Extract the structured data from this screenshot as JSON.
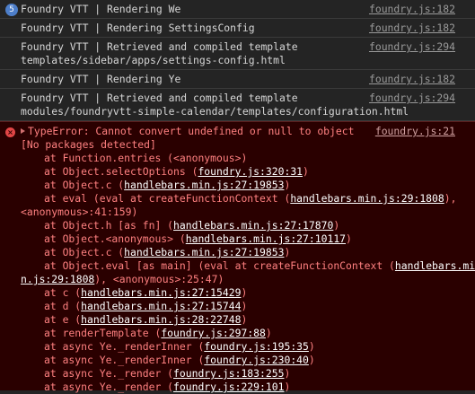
{
  "logs": [
    {
      "count": "5",
      "message": "Foundry VTT | Rendering We",
      "source": "foundry.js:182"
    },
    {
      "message": "Foundry VTT | Rendering SettingsConfig",
      "source": "foundry.js:182"
    },
    {
      "message": "Foundry VTT | Retrieved and compiled template\ntemplates/sidebar/apps/settings-config.html",
      "source": "foundry.js:294"
    },
    {
      "message": "Foundry VTT | Rendering Ye",
      "source": "foundry.js:182"
    },
    {
      "message": "Foundry VTT | Retrieved and compiled template\nmodules/foundryvtt-simple-calendar/templates/configuration.html",
      "source": "foundry.js:294"
    }
  ],
  "error": {
    "title": "TypeError: Cannot convert undefined or null to object",
    "source": "foundry.js:21",
    "detail": "[No packages detected]",
    "stack": [
      {
        "pre": "at Function.entries (<anonymous>)",
        "link": "",
        "post": ""
      },
      {
        "pre": "at Object.selectOptions (",
        "link": "foundry.js:320:31",
        "post": ")"
      },
      {
        "pre": "at Object.c (",
        "link": "handlebars.min.js:27:19853",
        "post": ")"
      },
      {
        "pre": "at eval (eval at createFunctionContext (",
        "link": "handlebars.min.js:29:1808",
        "post": "),"
      },
      {
        "cont": true,
        "pre": "<anonymous>:41:159)",
        "link": "",
        "post": ""
      },
      {
        "pre": "at Object.h [as fn] (",
        "link": "handlebars.min.js:27:17870",
        "post": ")"
      },
      {
        "pre": "at Object.<anonymous> (",
        "link": "handlebars.min.js:27:10117",
        "post": ")"
      },
      {
        "pre": "at Object.c (",
        "link": "handlebars.min.js:27:19853",
        "post": ")"
      },
      {
        "pre": "at Object.eval [as main] (eval at createFunctionContext (",
        "link": "handlebars.mi",
        "post": ""
      },
      {
        "cont": true,
        "pre": "",
        "link": "n.js:29:1808",
        "post": "), <anonymous>:25:47)"
      },
      {
        "pre": "at c (",
        "link": "handlebars.min.js:27:15429",
        "post": ")"
      },
      {
        "pre": "at d (",
        "link": "handlebars.min.js:27:15744",
        "post": ")"
      },
      {
        "pre": "at e (",
        "link": "handlebars.min.js:28:22748",
        "post": ")"
      },
      {
        "pre": "at renderTemplate (",
        "link": "foundry.js:297:88",
        "post": ")"
      },
      {
        "pre": "at async Ye._renderInner (",
        "link": "foundry.js:195:35",
        "post": ")"
      },
      {
        "pre": "at async Ye._renderInner (",
        "link": "foundry.js:230:40",
        "post": ")"
      },
      {
        "pre": "at async Ye._render (",
        "link": "foundry.js:183:255",
        "post": ")"
      },
      {
        "pre": "at async Ye._render (",
        "link": "foundry.js:229:101",
        "post": ")"
      }
    ]
  },
  "colors": {
    "background": "#242424",
    "error_background": "#2a0000",
    "error_text": "#ff8080",
    "badge": "#4d7ec9"
  }
}
